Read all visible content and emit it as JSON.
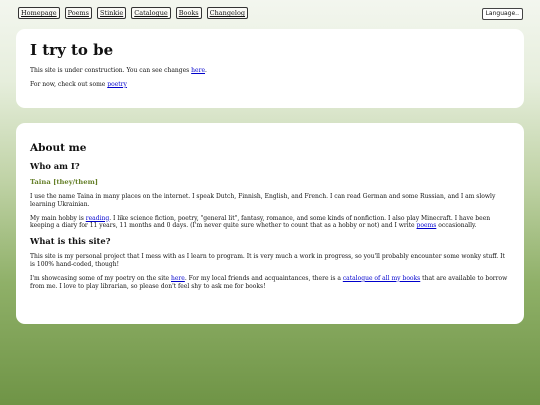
{
  "nav": {
    "items": [
      "Homepage",
      "Poems",
      "Stinkie",
      "Catalogue",
      "Books",
      "Changelog"
    ]
  },
  "language": {
    "label": "Language.."
  },
  "intro": {
    "title": "I try to be",
    "line1_prefix": "This site is under construction. You can see changes ",
    "line1_link": "here",
    "line1_suffix": ".",
    "line2_prefix": "For now, check out some ",
    "line2_link": "poetry"
  },
  "about": {
    "title": "About me",
    "who_heading": "Who am I?",
    "name_line": "Taina [they/them]",
    "p1": "I use the name Taina in many places on the internet. I speak Dutch, Finnish, English, and French. I can read German and some Russian, and I am slowly learning Ukrainian.",
    "p2_a": "My main hobby is ",
    "p2_link1": "reading",
    "p2_b": ". I like science fiction, poetry, \"general lit\", fantasy, romance, and some kinds of nonfiction. I also play Minecraft. I have been keeping a diary for 11 years, 11 months and 0 days. (I'm never quite sure whether to count that as a hobby or not) and I write ",
    "p2_link2": "poems",
    "p2_c": " occasionally.",
    "site_heading": "What is this site?",
    "p3": "This site is my personal project that I mess with as I learn to program. It is very much a work in progress, so you'll probably encounter some wonky stuff. It is 100% hand-coded, though!",
    "p4_a": "I'm showcasing some of my poetry on the site ",
    "p4_link1": "here",
    "p4_b": ". For my local friends and acquaintances, there is a ",
    "p4_link2": "catalogue of all my books",
    "p4_c": " that are available to borrow from me. I love to play librarian, so please don't feel shy to ask me for books!"
  }
}
